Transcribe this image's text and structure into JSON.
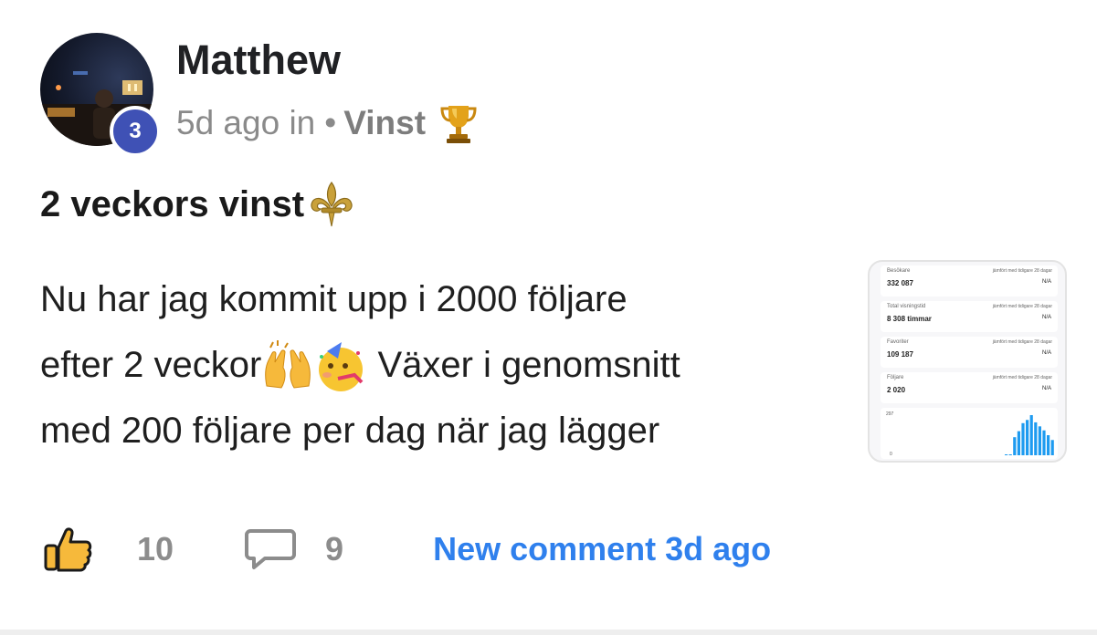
{
  "post": {
    "author": "Matthew",
    "level": "3",
    "time": "5d ago in",
    "separator": "•",
    "category": "Vinst",
    "title": "2 veckors vinst",
    "body_lines": [
      "Nu har jag kommit upp i 2000 följare",
      "efter 2 veckor",
      " Växer i genomsnitt",
      "med 200 följare per dag när jag lägger"
    ],
    "icons": {
      "category": "trophy-icon",
      "title": "fleur-de-lis-icon",
      "body_1": "raising-hands-emoji",
      "body_2": "partying-face-emoji",
      "like": "thumbs-up-icon",
      "comment": "comment-bubble-icon"
    }
  },
  "thumbnail": {
    "stats": [
      {
        "label": "Besökare",
        "value": "332 087",
        "compare": "jämfört med tidigare 28 dagar",
        "change": "N/A"
      },
      {
        "label": "Total visningstid",
        "value": "8 308 timmar",
        "compare": "jämfört med tidigare 28 dagar",
        "change": "N/A"
      },
      {
        "label": "Favoriter",
        "value": "109 187",
        "compare": "jämfört med tidigare 28 dagar",
        "change": "N/A"
      },
      {
        "label": "Följare",
        "value": "2 020",
        "compare": "jämfört med tidigare 28 dagar",
        "change": "N/A"
      }
    ],
    "chart": {
      "y_max_label": "297",
      "y_min_label": "0",
      "bars": [
        0.02,
        0.02,
        0.45,
        0.6,
        0.8,
        0.88,
        1.0,
        0.82,
        0.72,
        0.62,
        0.5,
        0.38
      ]
    },
    "bar_color": "#1e9bf0"
  },
  "footer": {
    "likes": "10",
    "comments": "9",
    "new_comment": "New comment 3d ago"
  },
  "colors": {
    "badge": "#3f51b5",
    "link": "#2f80ed"
  }
}
